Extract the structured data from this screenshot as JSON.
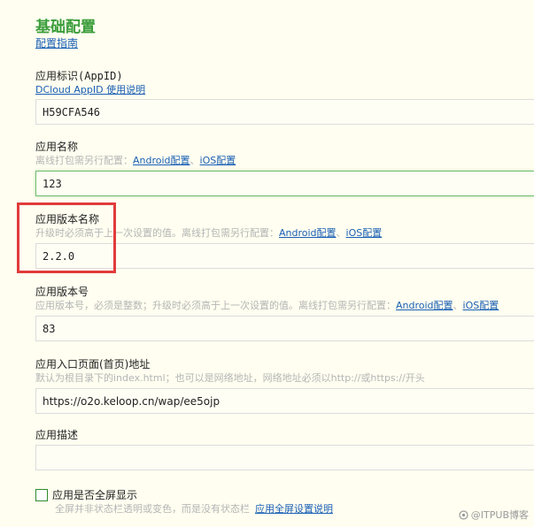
{
  "page": {
    "title": "基础配置",
    "guide_link": "配置指南"
  },
  "appid": {
    "label": "应用标识(AppID)",
    "help_link": "DCloud AppID 使用说明",
    "value": "H59CFA546"
  },
  "app_name": {
    "label": "应用名称",
    "hint": "离线打包需另行配置：",
    "android_link": "Android配置",
    "separator": "、",
    "ios_link": "iOS配置",
    "value": "123"
  },
  "version_name": {
    "label": "应用版本名称",
    "hint": "升级时必须高于上一次设置的值。离线打包需另行配置：",
    "android_link": "Android配置",
    "separator": "、",
    "ios_link": "iOS配置",
    "value": "2.2.0"
  },
  "version_code": {
    "label": "应用版本号",
    "hint": "应用版本号，必须是整数；升级时必须高于上一次设置的值。离线打包需另行配置：",
    "android_link": "Android配置",
    "separator": "、",
    "ios_link": "iOS配置",
    "value": "83"
  },
  "entry_page": {
    "label": "应用入口页面(首页)地址",
    "hint": "默认为根目录下的index.html；也可以是网络地址，网络地址必须以http://或https://开头",
    "value": "https://o2o.keloop.cn/wap/ee5ojp"
  },
  "description": {
    "label": "应用描述",
    "value": ""
  },
  "fullscreen": {
    "label": "应用是否全屏显示",
    "checked": false,
    "hint": "全屏并非状态栏透明或变色，而是没有状态栏",
    "help_link": "应用全屏设置说明"
  },
  "watermark": {
    "text": "@ITPUB博客"
  },
  "colors": {
    "title_green": "#3a9d3a",
    "link_blue": "#1a5fb4",
    "highlight_red": "#e13b3b",
    "background": "#fffef0"
  },
  "icons": {
    "watermark": "itpub-logo-icon"
  }
}
